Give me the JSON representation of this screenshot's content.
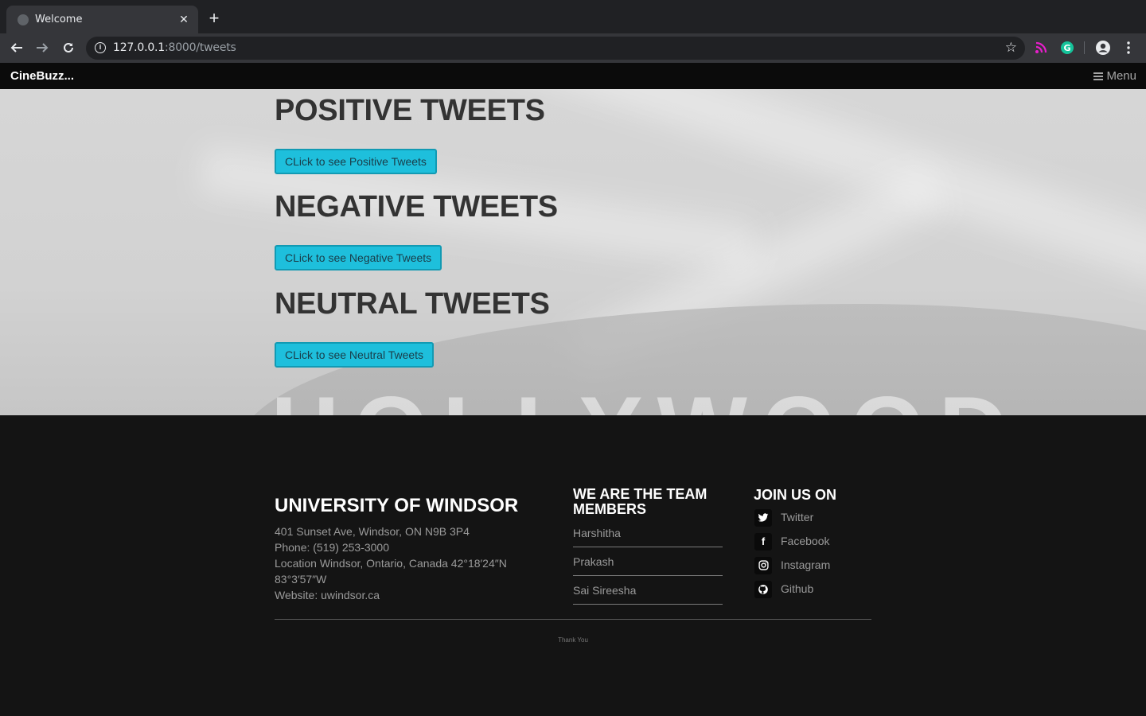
{
  "browser": {
    "tab_title": "Welcome",
    "url_host": "127.0.0.1",
    "url_rest": ":8000/tweets"
  },
  "site": {
    "brand": "CineBuzz...",
    "menu_label": "Menu"
  },
  "sections": [
    {
      "heading": "POSITIVE TWEETS",
      "button": "CLick to see Positive Tweets"
    },
    {
      "heading": "NEGATIVE TWEETS",
      "button": "CLick to see Negative Tweets"
    },
    {
      "heading": "NEUTRAL TWEETS",
      "button": "CLick to see Neutral Tweets"
    }
  ],
  "footer": {
    "university": {
      "title": "UNIVERSITY OF WINDSOR",
      "address": "401 Sunset Ave, Windsor, ON N9B 3P4",
      "phone": "Phone: (519) 253-3000",
      "location": "Location Windsor, Ontario, Canada 42°18′24″N 83°3′57″W",
      "website": "Website: uwindsor.ca"
    },
    "team": {
      "title": "WE ARE THE TEAM MEMBERS",
      "members": [
        "Harshitha",
        "Prakash",
        "Sai Sireesha"
      ]
    },
    "social": {
      "title": "JOIN US ON",
      "links": [
        {
          "label": "Twitter",
          "icon": "twitter-icon"
        },
        {
          "label": "Facebook",
          "icon": "facebook-icon"
        },
        {
          "label": "Instagram",
          "icon": "instagram-icon"
        },
        {
          "label": "Github",
          "icon": "github-icon"
        }
      ]
    },
    "thanks": "Thank You"
  },
  "colors": {
    "button": "#1ebfdc",
    "footer_bg": "#141414",
    "nav_bg": "#0b0b0b"
  }
}
